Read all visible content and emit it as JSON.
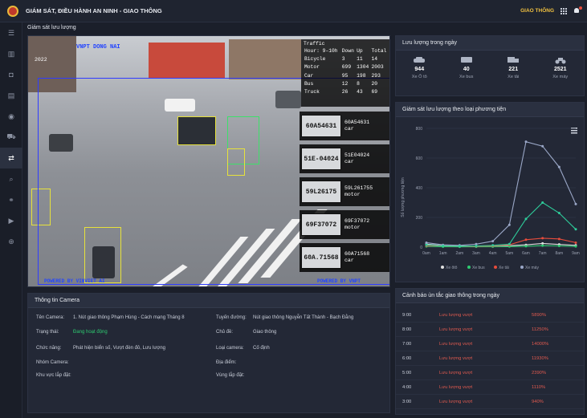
{
  "app": {
    "title": "GIÁM SÁT, ĐIỀU HÀNH AN NINH - GIAO THÔNG",
    "module": "GIAO THÔNG"
  },
  "breadcrumb": "Giám sát lưu lượng",
  "video": {
    "top_label": "VNPT DONG NAI",
    "year": "2022",
    "bottom_left": "POWERED BY VINVIET AI",
    "bottom_right": "POWERED BY VNPT",
    "traffic": {
      "title": "Traffic",
      "header": [
        "Hour: 9–10h",
        "Down",
        "Up",
        "Total"
      ],
      "rows": [
        [
          "Bicycle",
          "3",
          "11",
          "14"
        ],
        [
          "Motor",
          "699",
          "1304",
          "2003"
        ],
        [
          "Car",
          "95",
          "198",
          "293"
        ],
        [
          "Bus",
          "12",
          "8",
          "20"
        ],
        [
          "Truck",
          "26",
          "43",
          "69"
        ]
      ]
    },
    "plates": [
      {
        "number": "60A54631",
        "plate": "60A54631",
        "type": "car"
      },
      {
        "number": "51E04024",
        "plate": "51E-04024",
        "type": "car"
      },
      {
        "number": "59L261755",
        "plate": "59L26175",
        "type": "motor"
      },
      {
        "number": "69F37072",
        "plate": "69F37072",
        "type": "motor"
      },
      {
        "number": "60A71568",
        "plate": "60A.71568",
        "type": "car"
      }
    ]
  },
  "camera_info": {
    "title": "Thông tin Camera",
    "left": [
      {
        "label": "Tên Camera:",
        "value": "1. Nút giao thông Phạm Hùng - Cách mạng Tháng 8"
      },
      {
        "label": "Trạng thái:",
        "value": "Đang hoạt động"
      },
      {
        "label": "Chức năng:",
        "value": "Phát hiện biển số, Vượt đèn đỏ, Lưu lượng"
      },
      {
        "label": "Nhóm Camera:",
        "value": ""
      },
      {
        "label": "Khu vực lắp đặt:",
        "value": ""
      }
    ],
    "right": [
      {
        "label": "Tuyến đường:",
        "value": "Nút giao thông Nguyễn Tất Thành - Bạch Đằng"
      },
      {
        "label": "Chủ đề:",
        "value": "Giao thông"
      },
      {
        "label": "Loại camera:",
        "value": "Cố định"
      },
      {
        "label": "Địa điểm:",
        "value": ""
      },
      {
        "label": "Vùng lắp đặt:",
        "value": ""
      }
    ],
    "status_color": "#2ecc71"
  },
  "daily_count": {
    "title": "Lưu lượng trong ngày",
    "items": [
      {
        "value": "944",
        "label": "Xe Ô tô",
        "icon": "car-icon"
      },
      {
        "value": "40",
        "label": "Xe bus",
        "icon": "bus-icon"
      },
      {
        "value": "221",
        "label": "Xe tải",
        "icon": "truck-icon"
      },
      {
        "value": "2521",
        "label": "Xe máy",
        "icon": "motorbike-icon"
      }
    ]
  },
  "chart_panel": {
    "title": "Giám sát lưu lượng theo loại phương tiện",
    "y_label": "Số lượng phương tiện"
  },
  "chart_data": {
    "type": "line",
    "title": "Giám sát lưu lượng theo loại phương tiện",
    "ylabel": "Số lượng phương tiện",
    "x": [
      "0am",
      "1am",
      "2am",
      "3am",
      "4am",
      "5am",
      "6am",
      "7am",
      "8am",
      "9am"
    ],
    "ylim": [
      0,
      800
    ],
    "yticks": [
      0,
      200,
      400,
      600,
      800
    ],
    "series": [
      {
        "name": "Xe ôtô",
        "color": "#e0e0e0",
        "values": [
          20,
          10,
          8,
          6,
          8,
          10,
          15,
          25,
          18,
          12
        ]
      },
      {
        "name": "Xe bus",
        "color": "#2ecc71",
        "values": [
          5,
          3,
          2,
          2,
          3,
          4,
          6,
          10,
          8,
          5
        ]
      },
      {
        "name": "Xe tải",
        "color": "#e74c3c",
        "values": [
          10,
          8,
          6,
          6,
          8,
          15,
          50,
          60,
          55,
          30
        ]
      },
      {
        "name": "Xe máy",
        "color": "#9aa7c7",
        "values": [
          30,
          15,
          12,
          20,
          40,
          150,
          710,
          680,
          540,
          290
        ]
      },
      {
        "name": "",
        "color": "#2ecc9a",
        "values": [
          15,
          8,
          6,
          8,
          12,
          20,
          190,
          300,
          230,
          120
        ]
      }
    ],
    "legend": "bottom"
  },
  "alerts": {
    "title": "Cảnh báo ùn tắc giao thông trong ngày",
    "rows": [
      {
        "time": "9:00",
        "status": "Lưu lượng vượt",
        "percent": "5890%"
      },
      {
        "time": "8:00",
        "status": "Lưu lượng vượt",
        "percent": "11250%"
      },
      {
        "time": "7:00",
        "status": "Lưu lượng vượt",
        "percent": "14000%"
      },
      {
        "time": "6:00",
        "status": "Lưu lượng vượt",
        "percent": "11930%"
      },
      {
        "time": "5:00",
        "status": "Lưu lượng vượt",
        "percent": "2390%"
      },
      {
        "time": "4:00",
        "status": "Lưu lượng vượt",
        "percent": "1110%"
      },
      {
        "time": "3:00",
        "status": "Lưu lượng vượt",
        "percent": "940%"
      }
    ]
  },
  "sidebar": [
    "menu-icon",
    "chart-icon",
    "camera-icon",
    "document-icon",
    "shield-icon",
    "car-icon",
    "traffic-icon",
    "search-icon",
    "link-icon",
    "play-icon",
    "zoom-icon"
  ]
}
